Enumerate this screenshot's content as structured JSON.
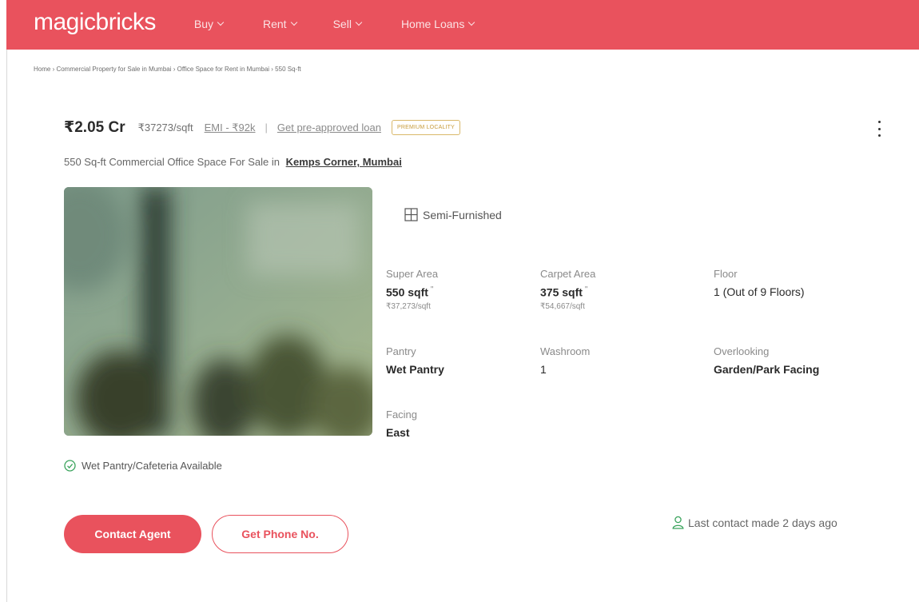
{
  "navbar": {
    "logo": "magicbricks",
    "items": [
      {
        "label": "Buy"
      },
      {
        "label": "Rent"
      },
      {
        "label": "Sell"
      },
      {
        "label": "Home Loans"
      }
    ],
    "color": "#e9525d"
  },
  "breadcrumb": "Home › Commercial Property for Sale in Mumbai › Office Space for Rent in Mumbai › 550 Sq-ft",
  "listing": {
    "price": "₹2.05 Cr",
    "price_per_sqft": "₹37273/sqft",
    "emi": "EMI - ₹92k",
    "separator": "|",
    "loan_link": "Get pre-approved loan",
    "badge": "PREMIUM LOCALITY",
    "subtitle": "550 Sq-ft Commercial Office Space For Sale in",
    "locality": "Kemps Corner, Mumbai",
    "furnishing": "Semi-Furnished",
    "amenity": "Wet Pantry/Cafeteria Available"
  },
  "details": {
    "super_area": {
      "label": "Super Area",
      "value": "550 sqft",
      "marker": "\"",
      "sub": "₹37,273/sqft"
    },
    "carpet_area": {
      "label": "Carpet Area",
      "value": "375 sqft",
      "marker": "\"",
      "sub": "₹54,667/sqft"
    },
    "floor": {
      "label": "Floor",
      "value": "1 (Out of 9 Floors)"
    },
    "pantry": {
      "label": "Pantry",
      "value": "Wet Pantry"
    },
    "washroom": {
      "label": "Washroom",
      "value": "1"
    },
    "overlooking": {
      "label": "Overlooking",
      "value": "Garden/Park Facing"
    },
    "facing": {
      "label": "Facing",
      "value": "East"
    }
  },
  "actions": {
    "contact_agent": "Contact Agent",
    "get_phone": "Get Phone No.",
    "last_contact": "Last contact made 2 days ago"
  },
  "icons": {
    "menu": "kebab-menu-icon",
    "furnishing": "furniture-icon",
    "amenity": "check-circle-icon",
    "last_contact": "person-icon"
  }
}
